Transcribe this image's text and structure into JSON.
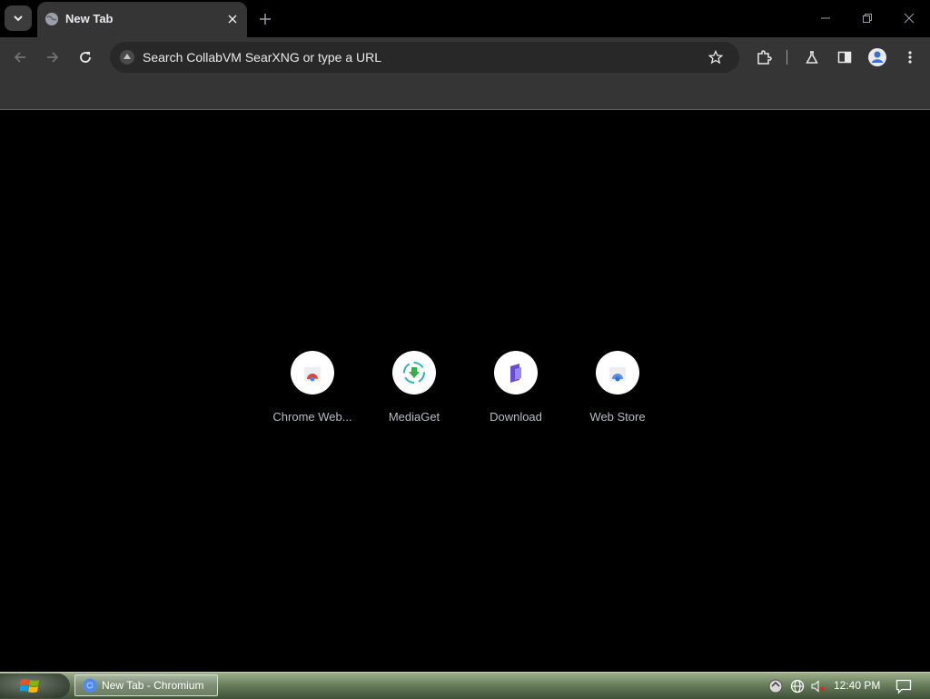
{
  "tabstrip": {
    "tab_title": "New Tab",
    "icons": {
      "tab_search": "chevron-down-icon",
      "favicon": "globe-icon",
      "close": "close-icon",
      "new_tab": "plus-icon",
      "minimize": "minimize-icon",
      "restore": "restore-icon",
      "close_window": "close-window-icon"
    }
  },
  "toolbar": {
    "omnibox_placeholder": "Search CollabVM SearXNG or type a URL",
    "icons": [
      "back-icon",
      "forward-icon",
      "reload-icon",
      "search-engine-icon",
      "star-icon",
      "extensions-icon",
      "labs-flask-icon",
      "side-panel-icon",
      "profile-icon",
      "menu-icon"
    ]
  },
  "ntp": {
    "shortcuts": [
      {
        "label": "Chrome Web...",
        "icon": "chrome-web-store-icon"
      },
      {
        "label": "MediaGet",
        "icon": "mediaget-icon"
      },
      {
        "label": "Download",
        "icon": "download-site-icon"
      },
      {
        "label": "Web Store",
        "icon": "web-store-icon"
      }
    ]
  },
  "taskbar": {
    "task_label": "New Tab - Chromium",
    "clock": "12:40 PM",
    "tray_icons": [
      "update-icon",
      "network-globe-icon",
      "volume-muted-icon"
    ],
    "notification_icon": "action-center-icon"
  },
  "colors": {
    "tab_bg": "#353535",
    "toolbar_bg": "#353535",
    "omnibox_bg": "#282828",
    "page_bg": "#000000"
  }
}
